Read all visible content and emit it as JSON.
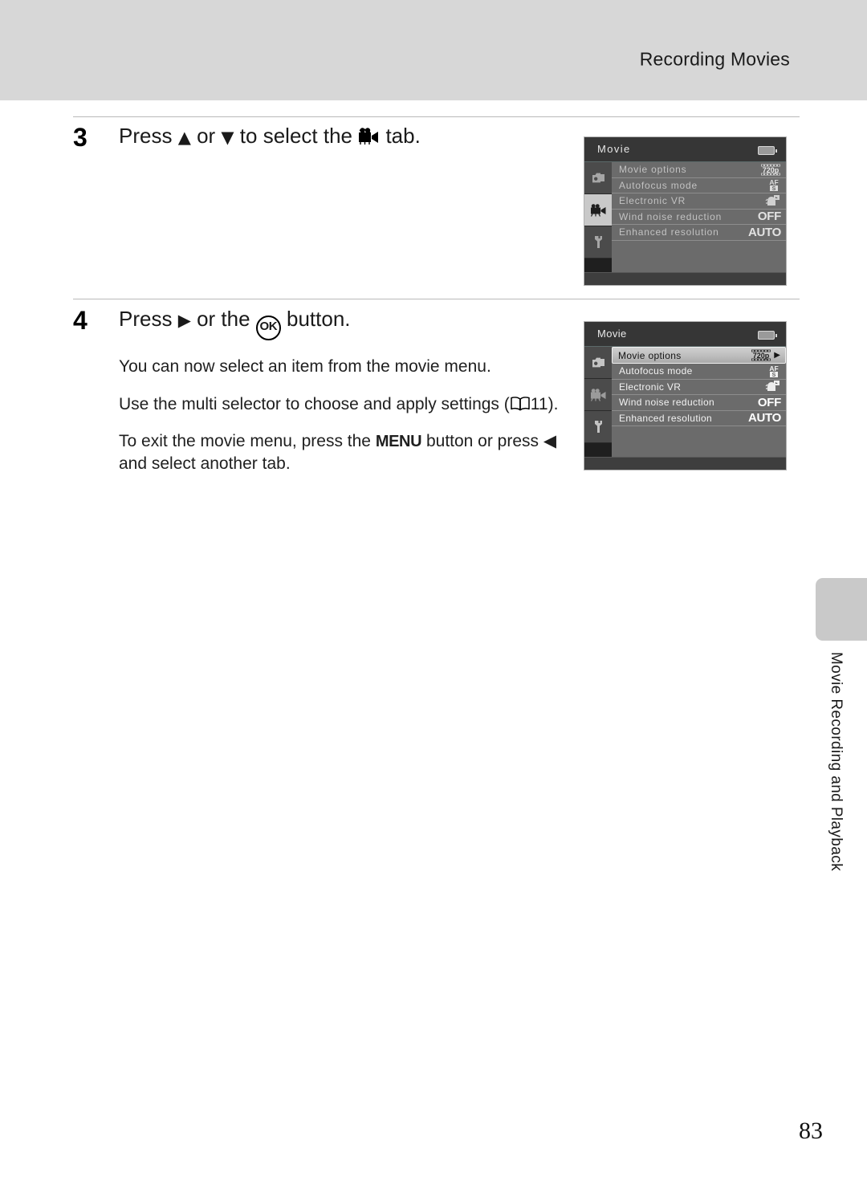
{
  "header": {
    "title": "Recording Movies"
  },
  "steps": [
    {
      "number": "3",
      "head_pre": "Press ",
      "head_mid1": " or ",
      "head_mid2": " to select the ",
      "head_post": " tab.",
      "glyph_up": "▲",
      "glyph_down": "▼",
      "glyph_tab_name": "movie-camera-icon"
    },
    {
      "number": "4",
      "head_pre": "Press ",
      "head_mid1": " or the ",
      "head_post": " button.",
      "glyph_right": "▶",
      "ok_label": "OK",
      "paragraphs": [
        {
          "text_a": "You can now select an item from the movie menu."
        },
        {
          "text_a": "Use the multi selector to choose and apply settings (",
          "ref": "11",
          "text_b": ")."
        },
        {
          "text_a": "To exit the movie menu, press the ",
          "menu_label": "MENU",
          "text_b": " button or press ",
          "glyph_left": "◀",
          "text_c": " and select another tab."
        }
      ]
    }
  ],
  "lcd_top": {
    "title": "Movie",
    "battery_icon": "battery-icon",
    "tabs": [
      {
        "icon": "shooting-camera-icon",
        "active": false
      },
      {
        "icon": "movie-camera-icon",
        "active": true
      },
      {
        "icon": "wrench-setup-icon",
        "active": false
      }
    ],
    "rows": [
      {
        "label": "Movie options",
        "value": "720p",
        "value_type": "pict-720p",
        "selected": false
      },
      {
        "label": "Autofocus mode",
        "value": "AF-S",
        "value_type": "pict-af",
        "selected": false
      },
      {
        "label": "Electronic VR",
        "value": "VR",
        "value_type": "pict-vr",
        "selected": false
      },
      {
        "label": "Wind noise reduction",
        "value": "OFF",
        "value_type": "text-bold",
        "selected": false
      },
      {
        "label": "Enhanced resolution",
        "value": "AUTO",
        "value_type": "text-bold",
        "selected": false
      }
    ]
  },
  "lcd_bottom": {
    "title": "Movie",
    "battery_icon": "battery-icon",
    "tabs": [
      {
        "icon": "shooting-camera-icon",
        "active": false
      },
      {
        "icon": "movie-camera-icon",
        "active": false
      },
      {
        "icon": "wrench-setup-icon",
        "active": false
      }
    ],
    "rows": [
      {
        "label": "Movie options",
        "value": "720p",
        "value_type": "pict-720p",
        "selected": true
      },
      {
        "label": "Autofocus mode",
        "value": "AF-S",
        "value_type": "pict-af",
        "selected": false
      },
      {
        "label": "Electronic VR",
        "value": "VR",
        "value_type": "pict-vr",
        "selected": false
      },
      {
        "label": "Wind noise reduction",
        "value": "OFF",
        "value_type": "text-bold",
        "selected": false
      },
      {
        "label": "Enhanced resolution",
        "value": "AUTO",
        "value_type": "text-bold",
        "selected": false
      }
    ]
  },
  "side_tab": {
    "label": "Movie Recording and Playback"
  },
  "footer": {
    "page_number": "83"
  },
  "colors": {
    "header_band": "#d7d7d7",
    "side_tab": "#c9c9c9",
    "lcd_list_bg": "#6b6b6b",
    "lcd_titlebar": "#363636"
  }
}
